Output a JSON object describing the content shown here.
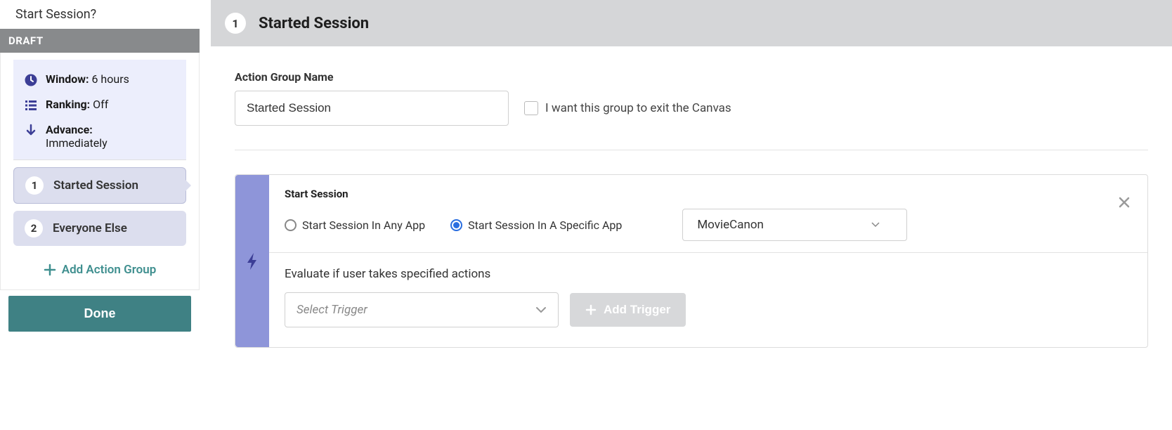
{
  "sidebar": {
    "header": "Start Session?",
    "draft": "DRAFT",
    "settings": {
      "window_label": "Window:",
      "window_value": "6 hours",
      "ranking_label": "Ranking:",
      "ranking_value": "Off",
      "advance_label": "Advance:",
      "advance_value": "Immediately"
    },
    "groups": [
      {
        "num": "1",
        "label": "Started Session",
        "selected": true
      },
      {
        "num": "2",
        "label": "Everyone Else",
        "selected": false
      }
    ],
    "add_group": "Add Action Group",
    "done": "Done"
  },
  "main": {
    "header_num": "1",
    "header_title": "Started Session",
    "field_label": "Action Group Name",
    "name_value": "Started Session",
    "exit_checkbox": "I want this group to exit the Canvas",
    "session": {
      "title": "Start Session",
      "radio_any": "Start Session In Any App",
      "radio_specific": "Start Session In A Specific App",
      "app_selected": "MovieCanon",
      "eval_text": "Evaluate if user takes specified actions",
      "trigger_placeholder": "Select Trigger",
      "add_trigger": "Add Trigger"
    }
  }
}
